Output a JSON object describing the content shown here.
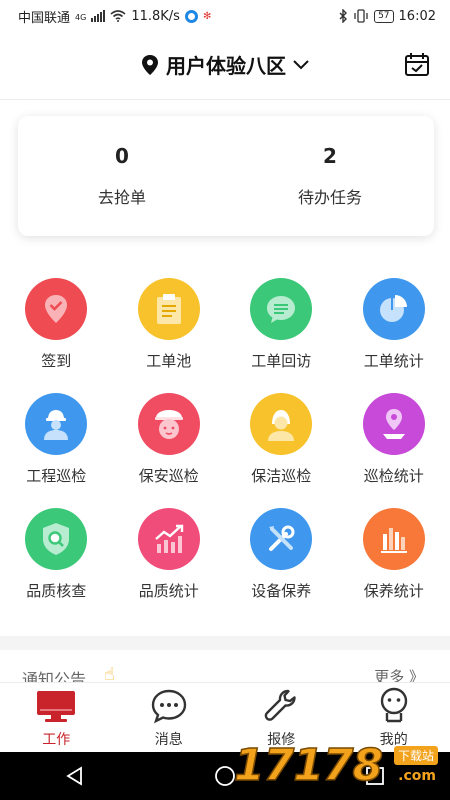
{
  "status_bar": {
    "carrier": "中国联通",
    "network": "4G",
    "speed": "11.8K/s",
    "battery": "57",
    "time": "16:02"
  },
  "header": {
    "location_name": "用户体验八区"
  },
  "task_summary": [
    {
      "count": "0",
      "label": "去抢单"
    },
    {
      "count": "2",
      "label": "待办任务"
    }
  ],
  "grid": [
    {
      "label": "签到",
      "icon": "checkin-icon",
      "color": "#ee4c52"
    },
    {
      "label": "工单池",
      "icon": "clipboard-icon",
      "color": "#f7c22b"
    },
    {
      "label": "工单回访",
      "icon": "chat-icon",
      "color": "#3cc879"
    },
    {
      "label": "工单统计",
      "icon": "pie-chart-icon",
      "color": "#3f98ee"
    },
    {
      "label": "工程巡检",
      "icon": "engineer-icon",
      "color": "#3f98ee"
    },
    {
      "label": "保安巡检",
      "icon": "security-guard-icon",
      "color": "#f04d63"
    },
    {
      "label": "保洁巡检",
      "icon": "cleaner-icon",
      "color": "#f7c22b"
    },
    {
      "label": "巡检统计",
      "icon": "map-pin-icon",
      "color": "#c74ad8"
    },
    {
      "label": "品质核查",
      "icon": "shield-search-icon",
      "color": "#3cc879"
    },
    {
      "label": "品质统计",
      "icon": "trend-chart-icon",
      "color": "#f04d7a"
    },
    {
      "label": "设备保养",
      "icon": "tools-icon",
      "color": "#3f98ee"
    },
    {
      "label": "保养统计",
      "icon": "bar-chart-icon",
      "color": "#f77838"
    }
  ],
  "notice": {
    "title": "通知公告",
    "more": "更多 》"
  },
  "tabs": [
    {
      "label": "工作",
      "icon": "monitor-icon",
      "active": true
    },
    {
      "label": "消息",
      "icon": "message-icon",
      "active": false
    },
    {
      "label": "报修",
      "icon": "wrench-icon",
      "active": false
    },
    {
      "label": "我的",
      "icon": "profile-icon",
      "active": false
    }
  ],
  "watermark": {
    "number": "17178",
    "suffix": ".com",
    "tag": "下载站"
  },
  "colors": {
    "accent": "#c9242b",
    "text": "#333333"
  }
}
